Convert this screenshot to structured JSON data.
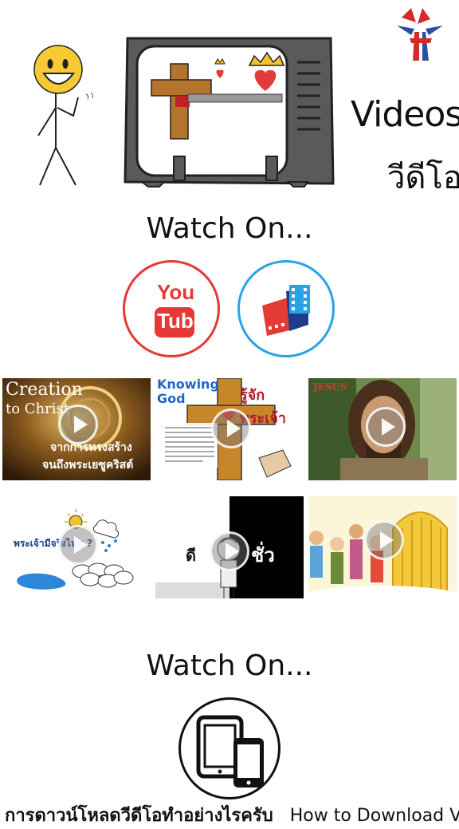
{
  "header": {
    "title_en": "Videos",
    "title_th": "วีดีโอ",
    "logo_icon": "cross-flag-logo-icon"
  },
  "sections": {
    "watch_on_1": "Watch On...",
    "watch_on_2": "Watch On..."
  },
  "platforms": {
    "youtube_line1": "You",
    "youtube_line2": "Tube",
    "youtube_color": "#e53935",
    "video_app_color": "#29a3e6"
  },
  "videos": [
    {
      "title_line1": "Creation",
      "title_line2": "to Christ",
      "subtitle_line1": "จากการทรงสร้าง",
      "subtitle_line2": "จนถึงพระเยซูคริสต์"
    },
    {
      "title_line1": "Knowing",
      "title_line2": "God",
      "subtitle_line1": "รู้จักพระเจ้า"
    },
    {
      "title_line1": "JESUS"
    },
    {
      "title_line1": "พระเจ้ามีจริงไหม ?"
    },
    {
      "title_line1": "ดี",
      "title_line2": "ชั่ว"
    },
    {
      "title_line1": ""
    }
  ],
  "footer": {
    "bold_text": "การดาวน์โหลดวีดีโอทำอย่างไรครับ",
    "text": "How to Download Video?"
  }
}
